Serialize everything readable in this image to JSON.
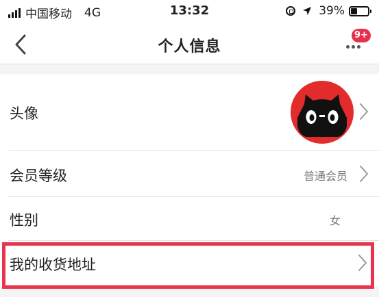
{
  "status_bar": {
    "carrier": "中国移动",
    "network": "4G",
    "time": "13:32",
    "battery_percent": "39%",
    "battery_level": 0.39
  },
  "nav": {
    "title": "个人信息",
    "badge": "9+"
  },
  "rows": [
    {
      "label": "头像"
    },
    {
      "label": "会员等级",
      "value": "普通会员"
    },
    {
      "label": "性别",
      "value": "女"
    },
    {
      "label": "我的收货地址"
    }
  ],
  "colors": {
    "accent_red": "#e8304a",
    "avatar_red": "#e22c2c",
    "highlight_border": "#e8344e"
  },
  "icons": [
    "signal-icon",
    "lock-rotation-icon",
    "location-arrow-icon",
    "battery-icon",
    "chevron-left-icon",
    "more-dots-icon",
    "chevron-right-icon",
    "tmall-cat-avatar"
  ]
}
